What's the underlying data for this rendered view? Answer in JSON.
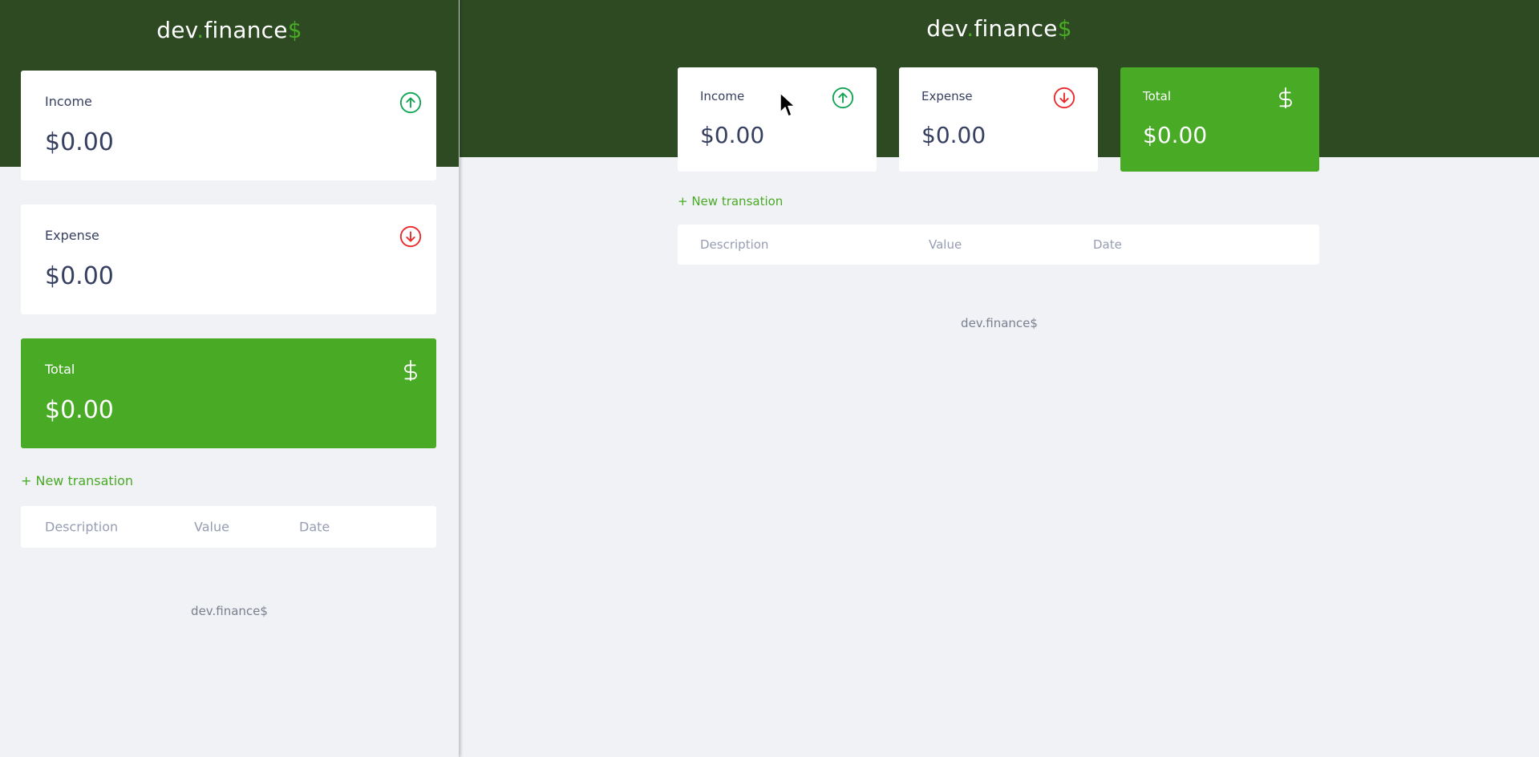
{
  "colors": {
    "header_bg": "#2d4a22",
    "accent_green": "#49aa26",
    "page_bg": "#f0f2f5",
    "card_text": "#363f5f",
    "income_icon": "#12a454",
    "expense_icon": "#e92929"
  },
  "brand": {
    "name": "dev",
    "dot": ".",
    "name2": "finance",
    "symbol": "$"
  },
  "cards": {
    "income": {
      "label": "Income",
      "value": "$0.00",
      "icon": "arrow-up-circle-icon"
    },
    "expense": {
      "label": "Expense",
      "value": "$0.00",
      "icon": "arrow-down-circle-icon"
    },
    "total": {
      "label": "Total",
      "value": "$0.00",
      "icon": "dollar-sign-icon"
    }
  },
  "actions": {
    "new_transaction": "+ New transation"
  },
  "table": {
    "columns": [
      "Description",
      "Value",
      "Date"
    ]
  },
  "footer": {
    "text": "dev.finance$"
  }
}
